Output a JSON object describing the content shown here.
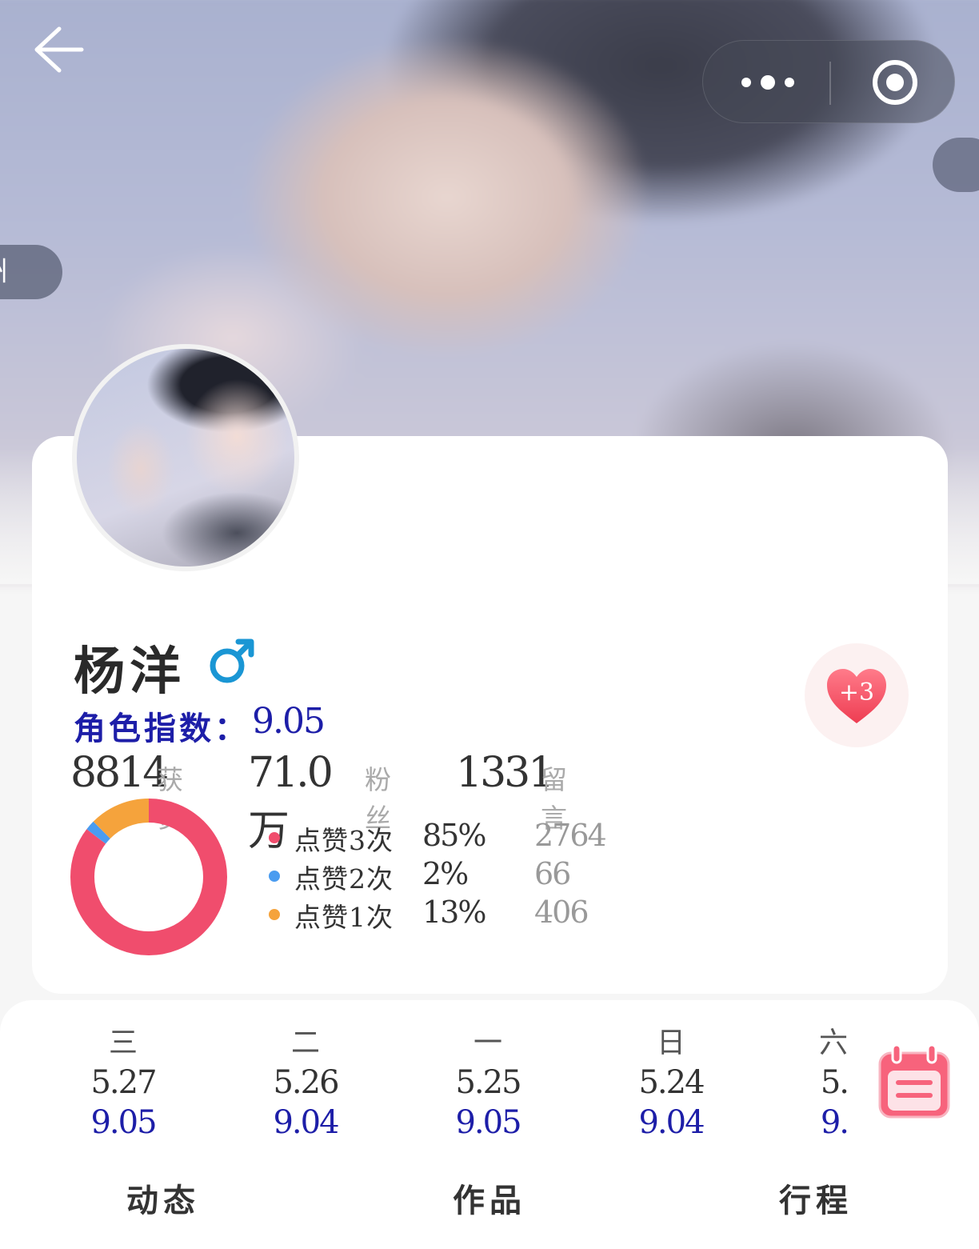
{
  "hero": {
    "side_tab_left_text": "州"
  },
  "nav": {
    "back_icon": "arrow-left-icon",
    "more_icon": "more-dots-icon",
    "close_icon": "target-circle-icon"
  },
  "profile": {
    "name": "杨洋",
    "gender_symbol": "♂",
    "gender_color": "#1a96d4",
    "index_label": "角色指数：",
    "index_value": "9.05",
    "stats": [
      {
        "value": "8814",
        "label": "获赞"
      },
      {
        "value": "71.0万",
        "label": "粉丝"
      },
      {
        "value": "1331",
        "label": "留言"
      }
    ],
    "like_button": {
      "count": "+3",
      "icon": "heart-icon",
      "color": "#f04a5e"
    }
  },
  "chart_data": {
    "type": "pie",
    "style": "donut",
    "series": [
      {
        "name": "点赞3次",
        "percent": "85%",
        "value": 2764,
        "color": "#f04d6d"
      },
      {
        "name": "点赞2次",
        "percent": "2%",
        "value": 66,
        "color": "#4a9cf0"
      },
      {
        "name": "点赞1次",
        "percent": "13%",
        "value": 406,
        "color": "#f5a33c"
      }
    ]
  },
  "daily_scores": [
    {
      "weekday": "三",
      "date": "5.27",
      "score": "9.05"
    },
    {
      "weekday": "二",
      "date": "5.26",
      "score": "9.04"
    },
    {
      "weekday": "一",
      "date": "5.25",
      "score": "9.05"
    },
    {
      "weekday": "日",
      "date": "5.24",
      "score": "9.04"
    },
    {
      "weekday": "六",
      "date": "5.",
      "score": "9."
    }
  ],
  "calendar_icon": "calendar-icon",
  "tabs": [
    {
      "label": "动态"
    },
    {
      "label": "作品"
    },
    {
      "label": "行程"
    }
  ],
  "colors": {
    "accent_blue": "#1d1ea8",
    "muted": "#aaaaaa"
  }
}
